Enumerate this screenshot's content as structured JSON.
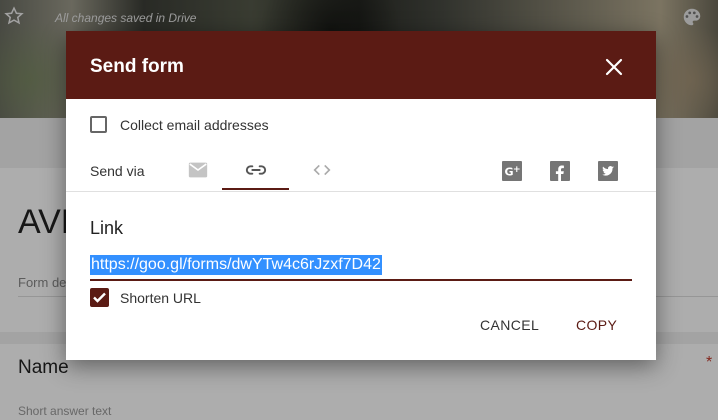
{
  "header": {
    "saved_status": "All changes saved in Drive"
  },
  "form": {
    "title": "AVE",
    "description_placeholder": "Form de",
    "question_title": "Name",
    "required_marker": "*",
    "answer_placeholder": "Short answer text"
  },
  "dialog": {
    "title": "Send form",
    "collect_email_label": "Collect email addresses",
    "send_via_label": "Send via",
    "tabs": [
      {
        "icon": "email-icon",
        "active": false
      },
      {
        "icon": "link-icon",
        "active": true
      },
      {
        "icon": "embed-icon",
        "active": false
      }
    ],
    "share": [
      "google-plus-icon",
      "facebook-icon",
      "twitter-icon"
    ],
    "link_heading": "Link",
    "url": "https://goo.gl/forms/dwYTw4c6rJzxf7D42",
    "shorten_url_label": "Shorten URL",
    "shorten_url_checked": true,
    "cancel_label": "CANCEL",
    "copy_label": "COPY"
  },
  "colors": {
    "accent": "#5b1b14",
    "selection": "#3390ff"
  }
}
